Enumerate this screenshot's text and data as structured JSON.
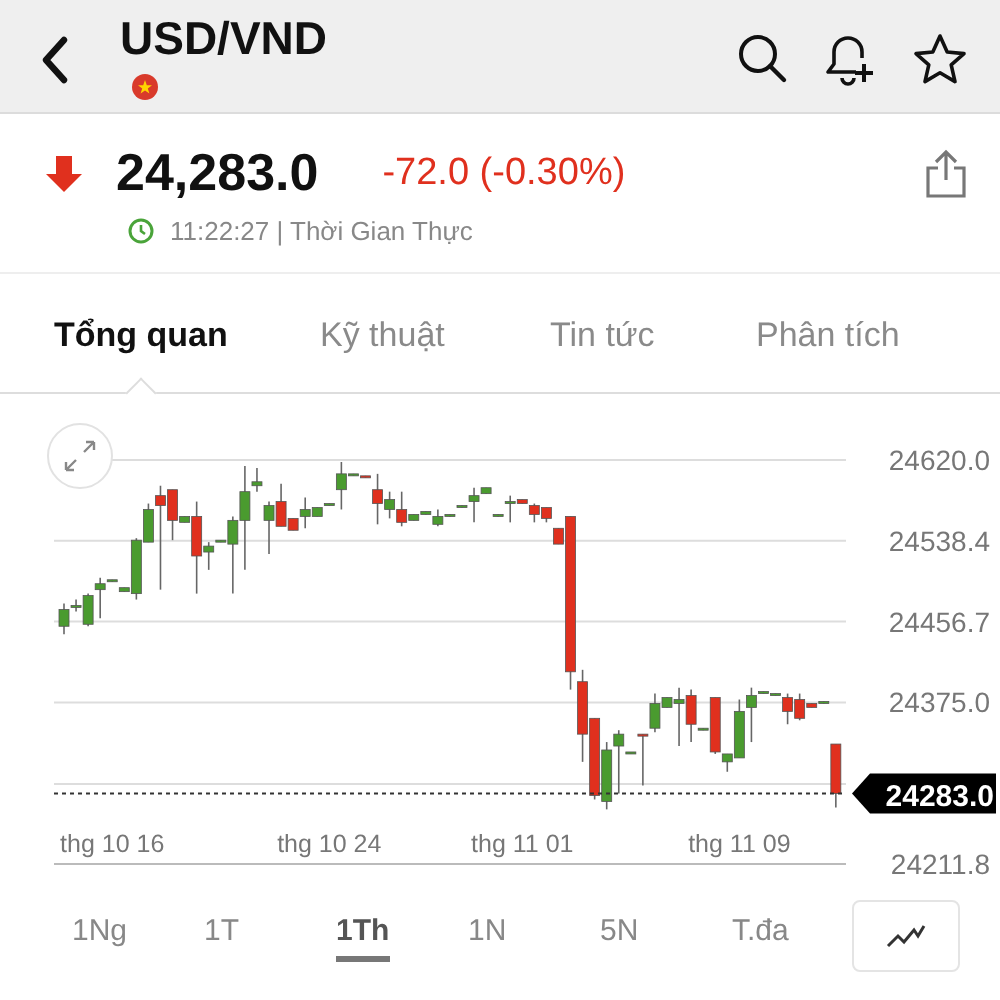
{
  "header": {
    "symbol": "USD/VND"
  },
  "quote": {
    "falling": true,
    "price": "24,283.0",
    "change": "-72.0 (-0.30%)",
    "time": "11:22:27 | Thời Gian Thực"
  },
  "tabs": [
    {
      "label": "Tổng quan",
      "selected": true
    },
    {
      "label": "Kỹ thuật",
      "selected": false
    },
    {
      "label": "Tin tức",
      "selected": false
    },
    {
      "label": "Phân tích",
      "selected": false
    }
  ],
  "chart": {
    "chart_data": {
      "type": "candlestick",
      "ylim": [
        24211.8,
        24620.0
      ],
      "grid": true,
      "ref_lines": [
        {
          "axis": "y",
          "value": 24283.0,
          "label": "24283.0",
          "color": "#333333"
        }
      ],
      "yticks": [
        {
          "value": 24620.0,
          "label": "24620.0"
        },
        {
          "value": 24538.4,
          "label": "24538.4"
        },
        {
          "value": 24456.7,
          "label": "24456.7"
        },
        {
          "value": 24375.0,
          "label": "24375.0"
        },
        {
          "value": 24211.8,
          "label": "24211.8"
        }
      ],
      "categories": [
        null,
        null,
        null,
        null,
        "thg 10 16",
        null,
        null,
        null,
        null,
        null,
        null,
        null,
        null,
        null,
        null,
        null,
        null,
        null,
        null,
        null,
        null,
        null,
        "thg 10 24",
        null,
        null,
        null,
        null,
        null,
        null,
        null,
        null,
        null,
        null,
        null,
        null,
        null,
        null,
        null,
        "thg 11 01",
        null,
        null,
        null,
        null,
        null,
        null,
        null,
        null,
        null,
        null,
        null,
        null,
        null,
        null,
        null,
        null,
        null,
        "thg 11 09",
        null,
        null,
        null,
        null,
        null,
        null,
        null,
        null
      ],
      "ohlc": [
        [
          24452,
          24475,
          24444,
          24469
        ],
        [
          24471,
          24479,
          24467,
          24473
        ],
        [
          24454,
          24485,
          24452,
          24483
        ],
        [
          24489,
          24501,
          24460,
          24495
        ],
        [
          24497,
          24499,
          24497,
          24499
        ],
        [
          24487,
          24491,
          24487,
          24491
        ],
        [
          24485,
          24541,
          24479,
          24539
        ],
        [
          24537,
          24576,
          24537,
          24570
        ],
        [
          24584,
          24594,
          24489,
          24574
        ],
        [
          24590,
          24590,
          24539,
          24559
        ],
        [
          24557,
          24563,
          24557,
          24563
        ],
        [
          24563,
          24578,
          24485,
          24523
        ],
        [
          24527,
          24537,
          24509,
          24533
        ],
        [
          24537,
          24539,
          24537,
          24539
        ],
        [
          24535,
          24563,
          24485,
          24559
        ],
        [
          24559,
          24614,
          24509,
          24588
        ],
        [
          24594,
          24612,
          24588,
          24598
        ],
        [
          24559,
          24578,
          24525,
          24574
        ],
        [
          24578,
          24596,
          24553,
          24553
        ],
        [
          24561,
          24561,
          24549,
          24549
        ],
        [
          24563,
          24582,
          24551,
          24570
        ],
        [
          24563,
          24572,
          24563,
          24572
        ],
        [
          24574,
          24576,
          24574,
          24576
        ],
        [
          24590,
          24618,
          24570,
          24606
        ],
        [
          24604,
          24606,
          24604,
          24606
        ],
        [
          24604,
          24604,
          24602,
          24602
        ],
        [
          24590,
          24606,
          24555,
          24576
        ],
        [
          24570,
          24588,
          24561,
          24580
        ],
        [
          24570,
          24588,
          24553,
          24557
        ],
        [
          24559,
          24565,
          24559,
          24565
        ],
        [
          24565,
          24568,
          24565,
          24568
        ],
        [
          24555,
          24570,
          24553,
          24563
        ],
        [
          24563,
          24565,
          24563,
          24565
        ],
        [
          24572,
          24574,
          24572,
          24574
        ],
        [
          24578,
          24592,
          24557,
          24584
        ],
        [
          24586,
          24592,
          24586,
          24592
        ],
        [
          24563,
          24565,
          24563,
          24565
        ],
        [
          24576,
          24584,
          24557,
          24578
        ],
        [
          24580,
          24580,
          24576,
          24576
        ],
        [
          24574,
          24576,
          24557,
          24565
        ],
        [
          24572,
          24572,
          24557,
          24561
        ],
        [
          24551,
          24551,
          24535,
          24535
        ],
        [
          24563,
          24563,
          24388,
          24406
        ],
        [
          24396,
          24408,
          24315,
          24343
        ],
        [
          24359,
          24359,
          24277,
          24281
        ],
        [
          24275,
          24335,
          24267,
          24327
        ],
        [
          24331,
          24347,
          24283,
          24343
        ],
        [
          24323,
          24325,
          24323,
          24325
        ],
        [
          24343,
          24343,
          24291,
          24341
        ],
        [
          24349,
          24384,
          24345,
          24374
        ],
        [
          24370,
          24380,
          24370,
          24380
        ],
        [
          24374,
          24390,
          24331,
          24378
        ],
        [
          24382,
          24388,
          24335,
          24353
        ],
        [
          24347,
          24349,
          24347,
          24349
        ],
        [
          24380,
          24380,
          24323,
          24325
        ],
        [
          24315,
          24323,
          24305,
          24323
        ],
        [
          24319,
          24378,
          24319,
          24366
        ],
        [
          24370,
          24390,
          24335,
          24382
        ],
        [
          24384,
          24386,
          24384,
          24386
        ],
        [
          24382,
          24384,
          24382,
          24384
        ],
        [
          24380,
          24384,
          24353,
          24366
        ],
        [
          24378,
          24384,
          24357,
          24359
        ],
        [
          24374,
          24374,
          24370,
          24370
        ],
        [
          24374,
          24376,
          24374,
          24376
        ],
        [
          24333,
          24333,
          24269,
          24283
        ]
      ]
    }
  },
  "periods": [
    {
      "label": "1Ng",
      "selected": false
    },
    {
      "label": "1T",
      "selected": false
    },
    {
      "label": "1Th",
      "selected": true
    },
    {
      "label": "1N",
      "selected": false
    },
    {
      "label": "5N",
      "selected": false
    },
    {
      "label": "T.đa",
      "selected": false
    }
  ]
}
